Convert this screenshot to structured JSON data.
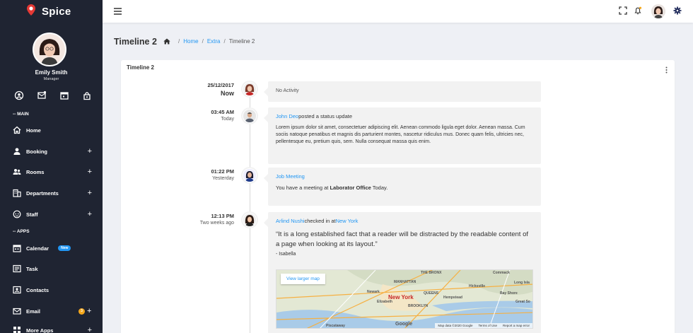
{
  "brand": {
    "name": "Spice"
  },
  "profile": {
    "name": "Emily Smith",
    "role": "Manager"
  },
  "sidebar": {
    "section_main": "-- MAIN",
    "section_apps": "-- APPS",
    "items": [
      {
        "label": "Home",
        "icon": "home-icon"
      },
      {
        "label": "Booking",
        "icon": "user-icon"
      },
      {
        "label": "Rooms",
        "icon": "users-icon"
      },
      {
        "label": "Departments",
        "icon": "building-icon"
      },
      {
        "label": "Staff",
        "icon": "face-icon"
      },
      {
        "label": "Calendar",
        "icon": "calendar-icon",
        "badge": "New"
      },
      {
        "label": "Task",
        "icon": "task-icon"
      },
      {
        "label": "Contacts",
        "icon": "contacts-icon"
      },
      {
        "label": "Email",
        "icon": "email-icon",
        "badge": "3"
      },
      {
        "label": "More Apps",
        "icon": "apps-icon"
      }
    ],
    "plus": "+"
  },
  "header": {
    "page_title": "Timeline 2"
  },
  "breadcrumb": {
    "home": "Home",
    "extra": "Extra",
    "current": "Timeline 2",
    "sep": "/"
  },
  "card": {
    "title": "Timeline 2"
  },
  "timeline": [
    {
      "date": "25/12/2017",
      "when": "Now",
      "text": "No Activity"
    },
    {
      "date": "03:45 AM",
      "when": "Today",
      "author": "John Deo",
      "action": "posted a status update",
      "body": "Lorem ipsum dolor sit amet, consectetuer adipiscing elit. Aenean commodo ligula eget dolor. Aenean massa. Cum sociis natoque penatibus et magnis dis parturient montes, nascetur ridiculus mus. Donec quam felis, ultricies nec, pellentesque eu, pretium quis, sem. Nulla consequat massa quis enim."
    },
    {
      "date": "01:22 PM",
      "when": "Yesterday",
      "title": "Job Meeting",
      "body_pre": "You have a meeting at ",
      "body_bold": "Laborator Office",
      "body_post": " Today."
    },
    {
      "date": "12:13 PM",
      "when": "Two weeks ago",
      "author": "Arlind Nushi",
      "action": "checked in at",
      "place": "New York",
      "quote": "“It is a long established fact that a reader will be distracted by the readable content of a page when looking at its layout.”",
      "quote_author": "- Isabella"
    }
  ],
  "map": {
    "button": "View larger map",
    "city": "New York",
    "brand": "Google",
    "footer": [
      "Map data ©2020 Google",
      "Terms of Use",
      "Report a map error"
    ],
    "places": [
      "Newark",
      "MANHATTAN",
      "BROOKLYN",
      "QUEENS",
      "Hempstead",
      "Hicksville",
      "Long Isla",
      "Bay Shore",
      "Great So",
      "Commack",
      "THE BRONX",
      "Piscataway",
      "Elizabeth"
    ]
  },
  "colors": {
    "sidebar": "#1f2432",
    "accent": "#2196f3",
    "badge_orange": "#f4a71c"
  }
}
